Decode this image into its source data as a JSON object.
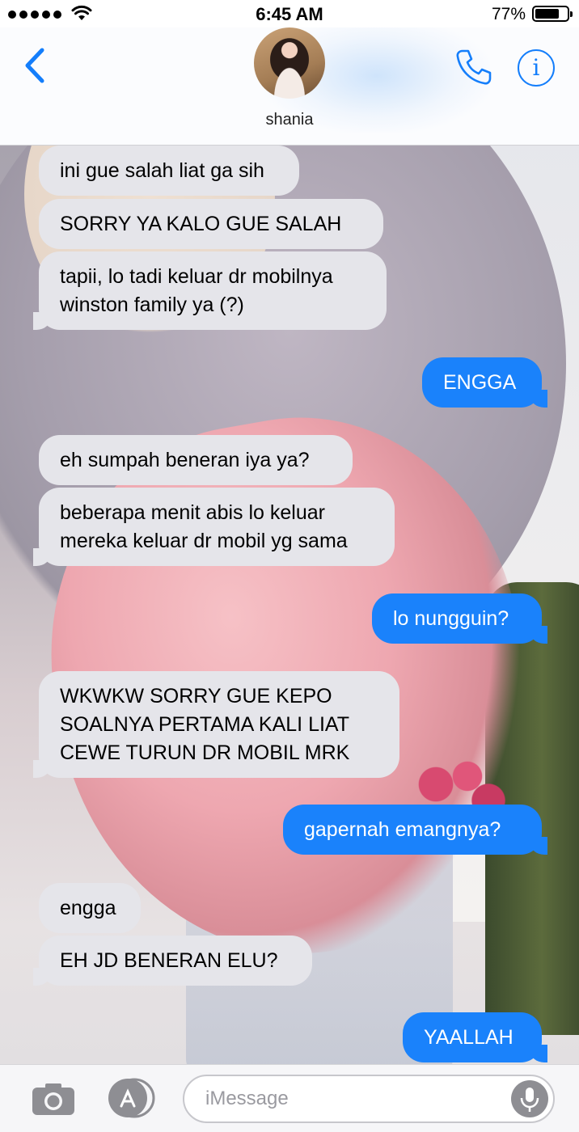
{
  "status_bar": {
    "time": "6:45 AM",
    "battery_percent": "77%",
    "battery_level": 0.77,
    "signal_bars": 5,
    "icons": [
      "signal-icon",
      "wifi-icon",
      "battery-icon"
    ]
  },
  "header": {
    "contact_name": "shania",
    "icons": [
      "back-chevron-icon",
      "phone-icon",
      "info-icon"
    ],
    "accent_color": "#147efb"
  },
  "messages": [
    {
      "direction": "in",
      "lines": [
        "ini gue salah liat ga sih"
      ]
    },
    {
      "direction": "in",
      "lines": [
        "SORRY YA KALO GUE SALAH"
      ]
    },
    {
      "direction": "in",
      "lines": [
        "tapii, lo tadi keluar dr mobilnya",
        "winston family ya (?)"
      ]
    },
    {
      "direction": "out",
      "lines": [
        "ENGGA"
      ]
    },
    {
      "direction": "in",
      "lines": [
        "eh sumpah beneran iya ya?"
      ]
    },
    {
      "direction": "in",
      "lines": [
        "beberapa menit abis lo keluar",
        "mereka keluar dr mobil yg sama"
      ]
    },
    {
      "direction": "out",
      "lines": [
        "lo nungguin?"
      ]
    },
    {
      "direction": "in",
      "lines": [
        "WKWKW SORRY GUE KEPO",
        "SOALNYA PERTAMA KALI LIAT",
        "CEWE TURUN DR MOBIL MRK"
      ]
    },
    {
      "direction": "out",
      "lines": [
        "gapernah emangnya?"
      ]
    },
    {
      "direction": "in",
      "lines": [
        "engga"
      ]
    },
    {
      "direction": "in",
      "lines": [
        "EH JD BENERAN ELU?"
      ]
    },
    {
      "direction": "out",
      "lines": [
        "YAALLAH"
      ]
    }
  ],
  "colors": {
    "incoming_bubble": "#e5e5ea",
    "outgoing_bubble": "#1a82fb"
  },
  "input_bar": {
    "placeholder": "iMessage",
    "value": "",
    "icons": [
      "camera-icon",
      "app-store-icon",
      "microphone-icon"
    ]
  }
}
